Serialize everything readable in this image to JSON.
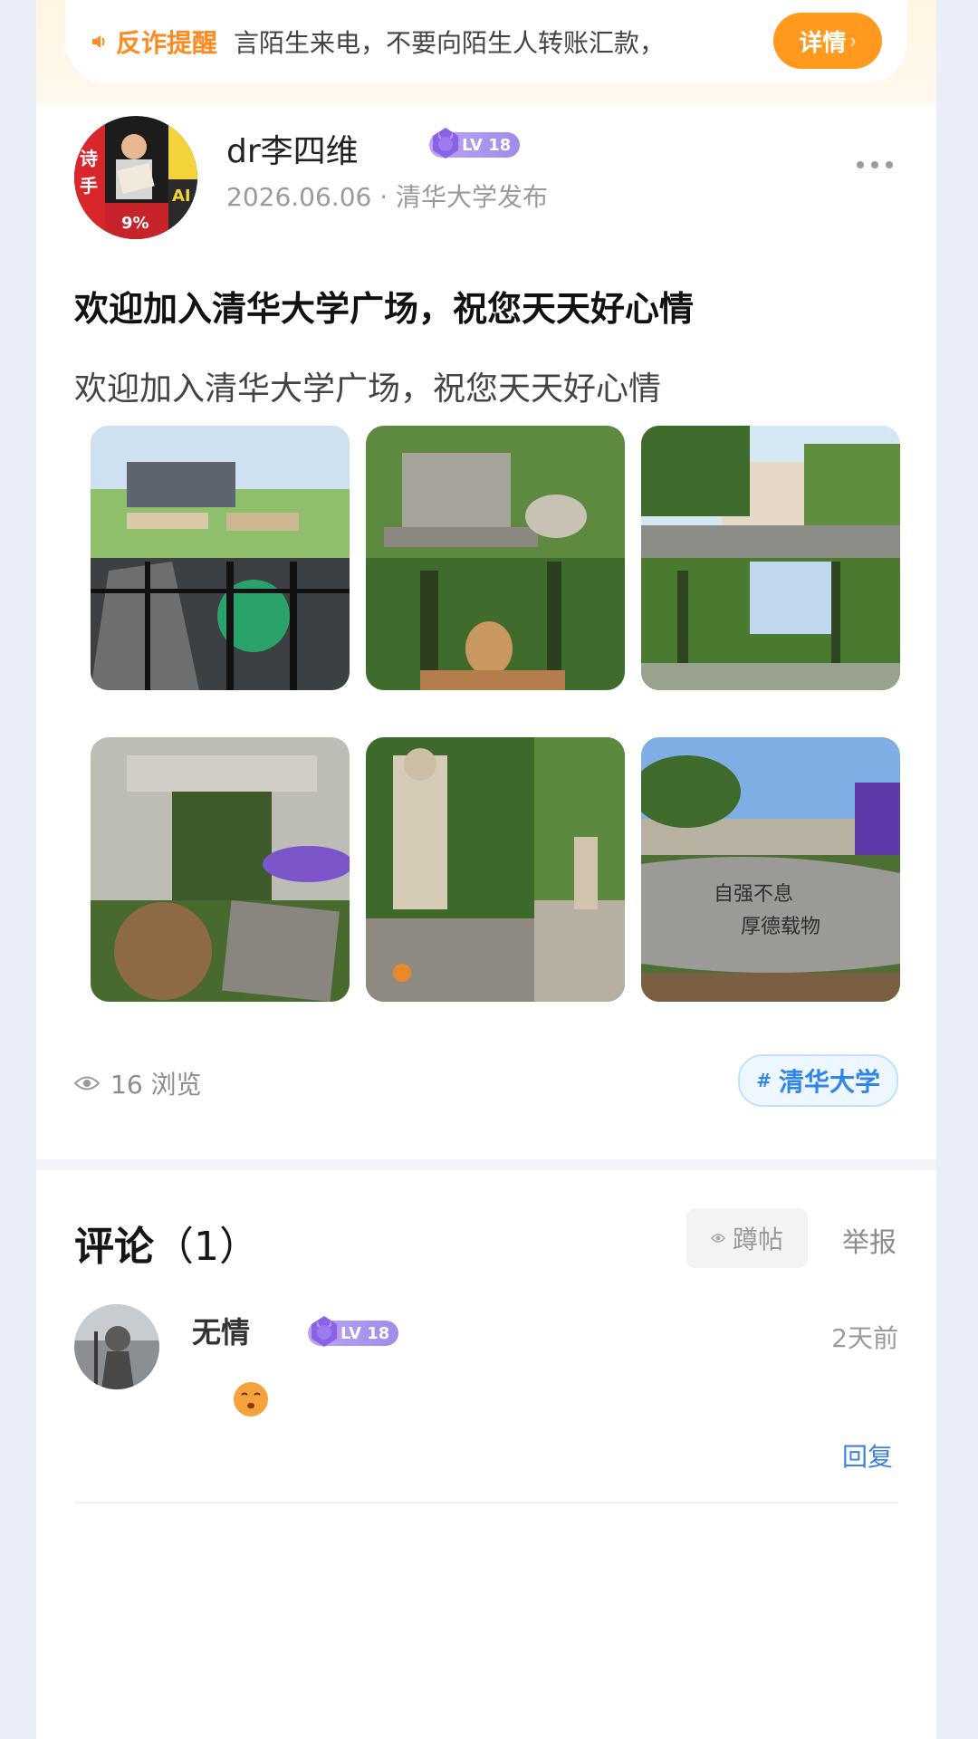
{
  "notice": {
    "icon": "speaker-icon",
    "label": "反诈提醒",
    "text": "言陌生来电，不要向陌生人转账汇款，",
    "button": "详情",
    "accent": "#ff9a1f"
  },
  "post": {
    "author": {
      "name": "dr李四维",
      "level": "LV 18",
      "meta": "2026.06.06 · 清华大学发布"
    },
    "title": "欢迎加入清华大学广场，祝您天天好心情",
    "body": "欢迎加入清华大学广场，祝您天天好心情",
    "photos": [
      "campus-collage-1",
      "campus-collage-2",
      "campus-collage-3",
      "campus-collage-4",
      "campus-collage-5",
      "campus-collage-6"
    ],
    "views": "16 浏览",
    "tag": "清华大学",
    "tag_color": "#2f86e6"
  },
  "comments": {
    "title": "评论",
    "count": "（1）",
    "pin_label": "蹲帖",
    "report_label": "举报",
    "items": [
      {
        "name": "无情",
        "level": "LV 18",
        "time": "2天前",
        "emoji": "kissing-face-icon",
        "reply": "回复"
      }
    ]
  }
}
